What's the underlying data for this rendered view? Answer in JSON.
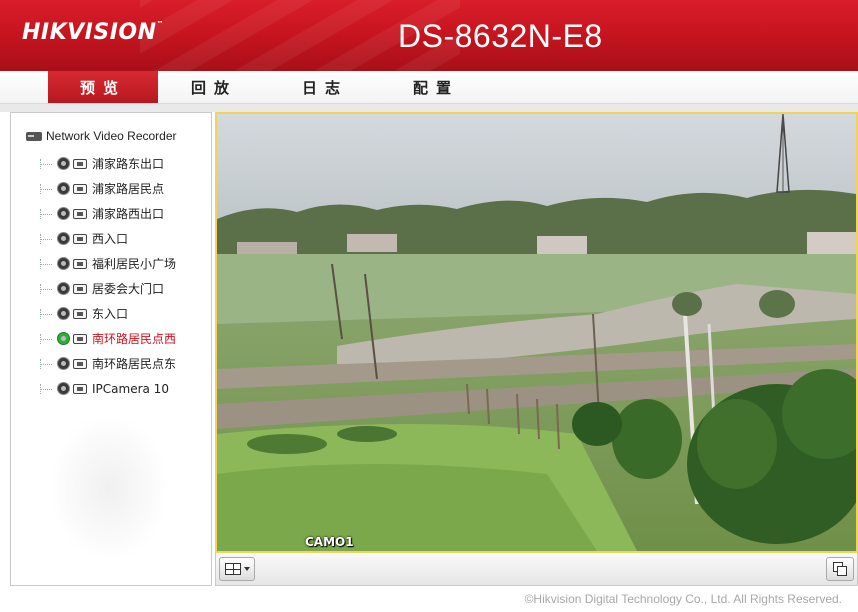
{
  "header": {
    "brand_hik": "HIK",
    "brand_vision": "VISION",
    "brand_tm": "™",
    "model": "DS-8632N-E8"
  },
  "nav": {
    "tabs": [
      {
        "label": "预览",
        "active": true
      },
      {
        "label": "回放",
        "active": false
      },
      {
        "label": "日志",
        "active": false
      },
      {
        "label": "配置",
        "active": false
      }
    ]
  },
  "sidebar": {
    "root_label": "Network Video Recorder",
    "items": [
      {
        "label": "浦家路东出口",
        "active": false
      },
      {
        "label": "浦家路居民点",
        "active": false
      },
      {
        "label": "浦家路西出口",
        "active": false
      },
      {
        "label": "西入口",
        "active": false
      },
      {
        "label": "福利居民小广场",
        "active": false
      },
      {
        "label": "居委会大门口",
        "active": false
      },
      {
        "label": "东入口",
        "active": false
      },
      {
        "label": "南环路居民点西",
        "active": true
      },
      {
        "label": "南环路居民点东",
        "active": false
      },
      {
        "label": "IPCamera 10",
        "active": false
      }
    ]
  },
  "video": {
    "camera_label": "CAMO1"
  },
  "toolbar": {
    "layout_icon": "grid-layout-icon",
    "fullscreen_icon": "fullscreen-icon"
  },
  "footer": {
    "copyright": "©Hikvision Digital Technology Co., Ltd. All Rights Reserved."
  },
  "colors": {
    "header_red": "#c8151f",
    "active_tab": "#c42028",
    "active_item_text": "#d0111c",
    "video_border": "#f1d35a"
  }
}
